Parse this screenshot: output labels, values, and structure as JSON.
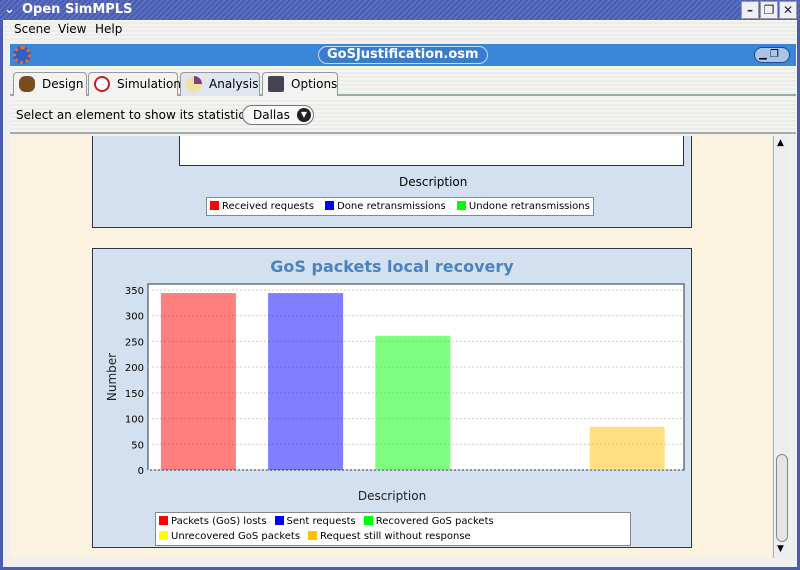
{
  "window": {
    "title": "Open SimMPLS"
  },
  "menu": [
    "Scene",
    "View",
    "Help"
  ],
  "document": {
    "title": "GoSJustification.osm"
  },
  "tabs": [
    {
      "label": "Design"
    },
    {
      "label": "Simulation"
    },
    {
      "label": "Analysis",
      "selected": true
    },
    {
      "label": "Options"
    }
  ],
  "selector": {
    "label": "Select an element to show its statistics",
    "value": "Dallas"
  },
  "top_chart": {
    "xlabel": "Description",
    "legend": [
      {
        "label": "Received requests",
        "color": "#ff0000"
      },
      {
        "label": "Done retransmissions",
        "color": "#0000ff"
      },
      {
        "label": "Undone retransmissions",
        "color": "#00ff00"
      }
    ]
  },
  "chart_data": {
    "type": "bar",
    "title": "GoS packets local recovery",
    "xlabel": "Description",
    "ylabel": "Number",
    "ylim": [
      0,
      350
    ],
    "yticks": [
      0,
      50,
      100,
      150,
      200,
      250,
      300,
      350
    ],
    "series": [
      {
        "name": "Packets (GoS) losts",
        "value": 344,
        "color": "#ff0000"
      },
      {
        "name": "Sent requests",
        "value": 344,
        "color": "#0000ff"
      },
      {
        "name": "Recovered GoS packets",
        "value": 261,
        "color": "#00ff00"
      },
      {
        "name": "Unrecovered GoS packets",
        "value": 0,
        "color": "#ffff00"
      },
      {
        "name": "Request still without response",
        "value": 84,
        "color": "#ffc000"
      }
    ],
    "legend_position": "bottom",
    "grid": true
  }
}
